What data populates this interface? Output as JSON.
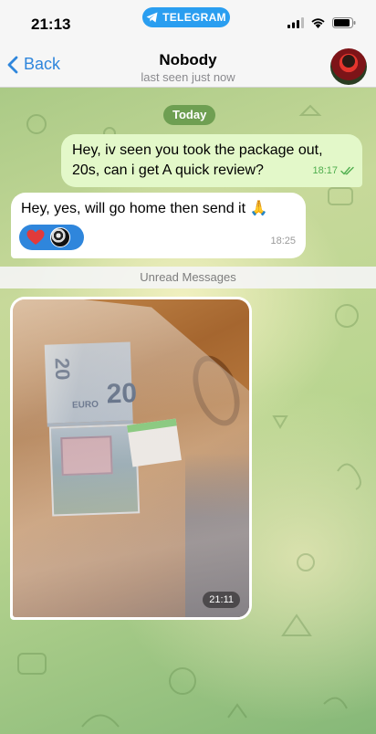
{
  "status_bar": {
    "time": "21:13",
    "app_pill": "TELEGRAM"
  },
  "header": {
    "back_label": "Back",
    "title": "Nobody",
    "subtitle": "last seen just now"
  },
  "date_chip": "Today",
  "messages": [
    {
      "direction": "outgoing",
      "text": "Hey, iv seen you took the package out, 20s, can i get A quick review?",
      "time": "18:17",
      "status": "read"
    },
    {
      "direction": "incoming",
      "text": "Hey, yes, will go home then send it 🙏",
      "time": "18:25",
      "reactions": [
        "heart"
      ]
    }
  ],
  "unread_label": "Unread Messages",
  "photo_message": {
    "direction": "incoming",
    "time": "21:11",
    "banknote_denomination": "20"
  },
  "colors": {
    "accent": "#2f86dc",
    "outgoing_bubble": "#e3f8c9",
    "incoming_bubble": "#ffffff",
    "read_check": "#4fae4e",
    "date_chip": "#629648"
  }
}
